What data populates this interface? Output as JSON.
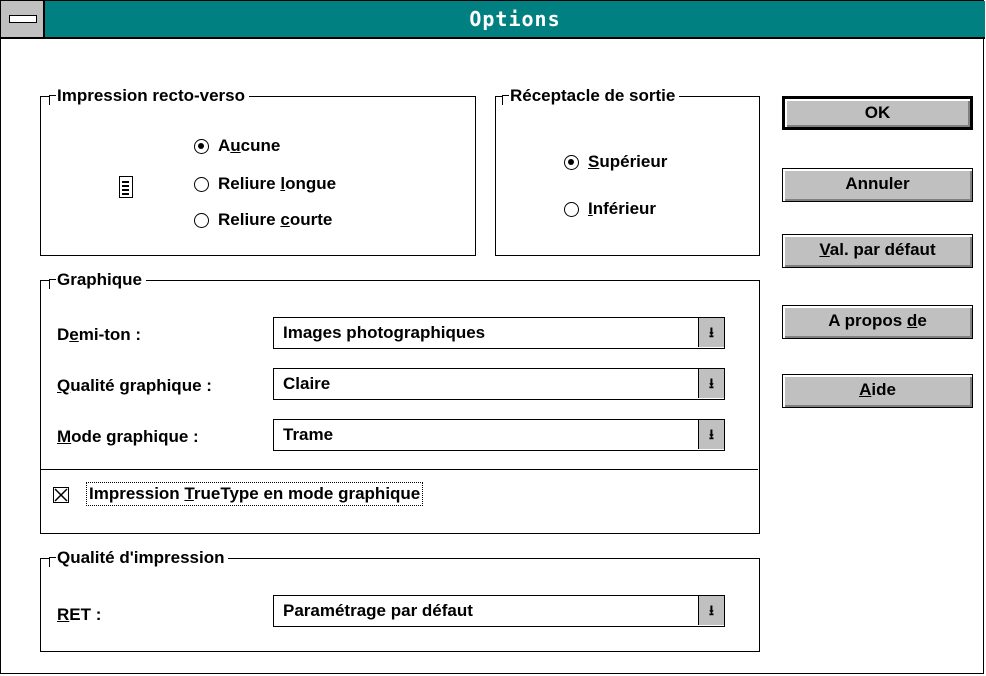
{
  "window": {
    "title": "Options"
  },
  "duplex": {
    "legend": "Impression recto-verso",
    "options": [
      {
        "pre": "A",
        "key": "u",
        "post": "cune",
        "selected": true
      },
      {
        "pre": "Reliure ",
        "key": "l",
        "post": "ongue",
        "selected": false
      },
      {
        "pre": "Reliure ",
        "key": "c",
        "post": "ourte",
        "selected": false
      }
    ]
  },
  "output_tray": {
    "legend": "Réceptacle de sortie",
    "options": [
      {
        "pre": "",
        "key": "S",
        "post": "upérieur",
        "selected": true
      },
      {
        "pre": "",
        "key": "I",
        "post": "nférieur",
        "selected": false
      }
    ]
  },
  "buttons": {
    "ok": {
      "pre": "OK",
      "key": "",
      "post": ""
    },
    "cancel": {
      "pre": "Annuler",
      "key": "",
      "post": ""
    },
    "defaults": {
      "pre": "",
      "key": "V",
      "post": "al. par défaut"
    },
    "about": {
      "pre": "A propos ",
      "key": "d",
      "post": "e"
    },
    "help": {
      "pre": "",
      "key": "A",
      "post": "ide"
    }
  },
  "graphics": {
    "legend": "Graphique",
    "halftone": {
      "pre": "D",
      "key": "e",
      "post": "mi-ton :",
      "value": "Images photographiques"
    },
    "quality": {
      "pre": "",
      "key": "Q",
      "post": "ualité graphique :",
      "value": "Claire"
    },
    "mode": {
      "pre": "",
      "key": "M",
      "post": "ode graphique :",
      "value": "Trame"
    },
    "truetype": {
      "pre": "Impression ",
      "key": "T",
      "post": "rueType en mode graphique",
      "checked": true
    }
  },
  "print_quality": {
    "legend": "Qualité d'impression",
    "ret": {
      "pre": "",
      "key": "R",
      "post": "ET :",
      "value": "Paramétrage par défaut"
    }
  },
  "icons": {
    "dropdown": "arrow-down-icon",
    "document": "page-icon",
    "system_menu": "system-menu-icon"
  }
}
